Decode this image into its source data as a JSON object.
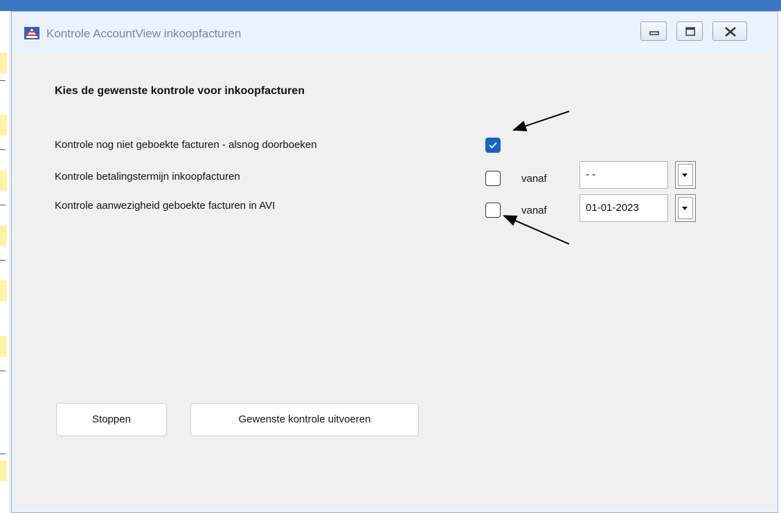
{
  "window": {
    "title": "Kontrole AccountView inkoopfacturen",
    "buttons": [
      "minimize",
      "maximize",
      "close"
    ]
  },
  "heading": "Kies de gewenste kontrole voor inkoopfacturen",
  "options": [
    {
      "label": "Kontrole nog niet geboekte facturen - alsnog doorboeken",
      "checked": true
    },
    {
      "label": "Kontrole betalingstermijn inkoopfacturen",
      "checked": false,
      "vanaf_label": "vanaf",
      "date_value": "- -"
    },
    {
      "label": "Kontrole aanwezigheid geboekte facturen in AVI",
      "checked": false,
      "vanaf_label": "vanaf",
      "date_value": "01-01-2023"
    }
  ],
  "buttons": {
    "stop": "Stoppen",
    "run": "Gewenste kontrole uitvoeren"
  },
  "colors": {
    "accent": "#1a64c8",
    "window_bg": "#f0f0f0",
    "frame": "#eaf2fb"
  },
  "icons": [
    "app-icon",
    "minimize-icon",
    "maximize-icon",
    "close-icon",
    "checkmark-icon",
    "dropdown-arrow-icon"
  ]
}
